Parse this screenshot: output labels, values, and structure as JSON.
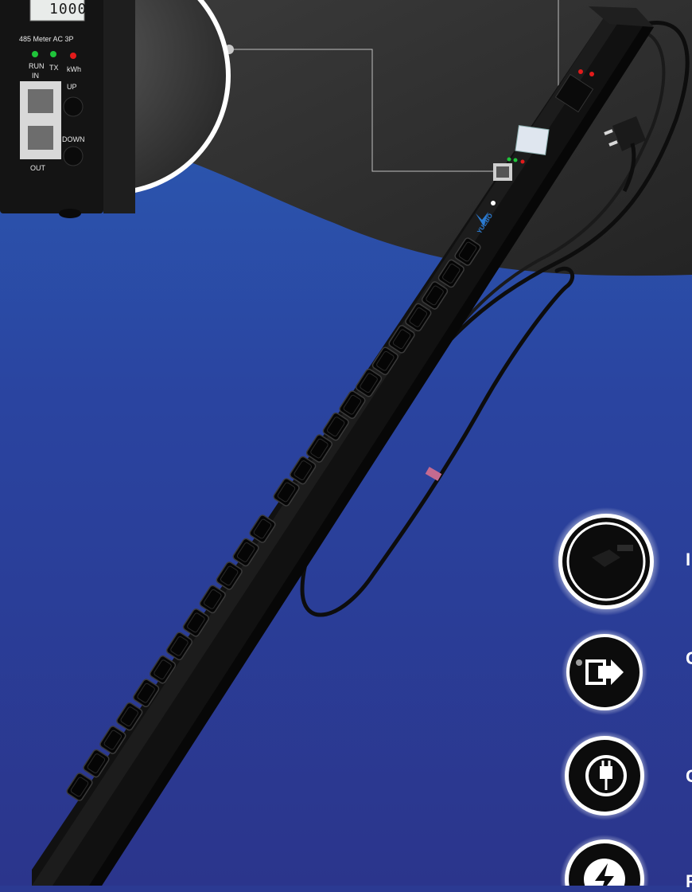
{
  "inset": {
    "display_value": "1000",
    "header": "485 Meter AC 3P",
    "led_labels": [
      "RUN",
      "TX",
      "kWh"
    ],
    "port_in_label": "IN",
    "port_out_label": "OUT",
    "button_up_label": "UP",
    "button_down_label": "DOWN"
  },
  "product": {
    "brand": "YUEBO",
    "outlet_count_upper": 12,
    "outlet_count_lower": 12
  },
  "features": [
    {
      "icon": "plug-icon",
      "label": "I"
    },
    {
      "icon": "output-icon",
      "label": "C"
    },
    {
      "icon": "power-plug-icon",
      "label": "C"
    },
    {
      "icon": "lightning-icon",
      "label": "P"
    }
  ],
  "colors": {
    "background_blue": "#2b3a92",
    "upper_dark": "#2e2e2e",
    "device_black": "#111111",
    "led_green": "#1fc43a",
    "led_red": "#e31b1b"
  }
}
